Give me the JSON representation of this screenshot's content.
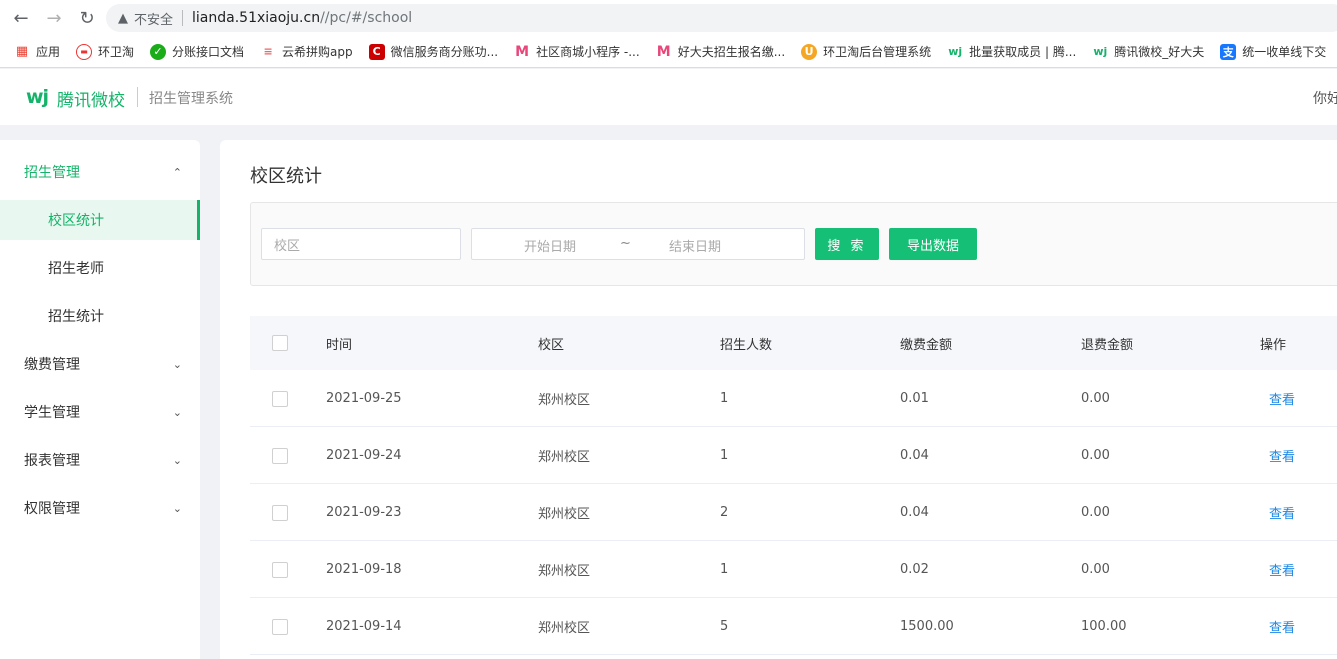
{
  "browser": {
    "insecure_label": "不安全",
    "url_host": "lianda.51xiaoju.cn",
    "url_path": "//pc/#/school",
    "bookmarks": [
      {
        "icon": "apps-grid-icon",
        "label": "应用"
      },
      {
        "icon": "huanweitao-icon",
        "label": "环卫淘"
      },
      {
        "icon": "wechat-icon",
        "label": "分账接口文档"
      },
      {
        "icon": "cloud-icon",
        "label": "云希拼购app"
      },
      {
        "icon": "c-logo-icon",
        "label": "微信服务商分账功..."
      },
      {
        "icon": "m-logo-icon",
        "label": "社区商城小程序 -..."
      },
      {
        "icon": "m-logo-icon",
        "label": "好大夫招生报名缴..."
      },
      {
        "icon": "shield-logo-icon",
        "label": "环卫淘后台管理系统"
      },
      {
        "icon": "wj-logo-icon",
        "label": "批量获取成员 | 腾..."
      },
      {
        "icon": "wj-logo-icon",
        "label": "腾讯微校_好大夫"
      },
      {
        "icon": "alipay-icon",
        "label": "统一收单线下交"
      }
    ]
  },
  "header": {
    "logo_mark": "wj",
    "logo_text": "腾讯微校",
    "system_name": "招生管理系统",
    "greeting": "你好"
  },
  "sidebar": {
    "menus": [
      {
        "label": "招生管理",
        "expanded": true,
        "children": [
          {
            "label": "校区统计",
            "active": true
          },
          {
            "label": "招生老师",
            "active": false
          },
          {
            "label": "招生统计",
            "active": false
          }
        ]
      },
      {
        "label": "缴费管理",
        "expanded": false
      },
      {
        "label": "学生管理",
        "expanded": false
      },
      {
        "label": "报表管理",
        "expanded": false
      },
      {
        "label": "权限管理",
        "expanded": false
      }
    ]
  },
  "main": {
    "title": "校区统计",
    "filters": {
      "campus_placeholder": "校区",
      "start_placeholder": "开始日期",
      "range_separator": "~",
      "end_placeholder": "结束日期",
      "search_label": "搜 索",
      "export_label": "导出数据"
    },
    "table": {
      "columns": [
        "时间",
        "校区",
        "招生人数",
        "缴费金额",
        "退费金额",
        "操作"
      ],
      "rows": [
        {
          "time": "2021-09-25",
          "campus": "郑州校区",
          "count": "1",
          "payment": "0.01",
          "refund": "0.00",
          "action": "查看"
        },
        {
          "time": "2021-09-24",
          "campus": "郑州校区",
          "count": "1",
          "payment": "0.04",
          "refund": "0.00",
          "action": "查看"
        },
        {
          "time": "2021-09-23",
          "campus": "郑州校区",
          "count": "2",
          "payment": "0.04",
          "refund": "0.00",
          "action": "查看"
        },
        {
          "time": "2021-09-18",
          "campus": "郑州校区",
          "count": "1",
          "payment": "0.02",
          "refund": "0.00",
          "action": "查看"
        },
        {
          "time": "2021-09-14",
          "campus": "郑州校区",
          "count": "5",
          "payment": "1500.00",
          "refund": "100.00",
          "action": "查看"
        }
      ]
    }
  },
  "colors": {
    "accent": "#15b36a",
    "button": "#15c076",
    "link": "#1e88e5"
  }
}
